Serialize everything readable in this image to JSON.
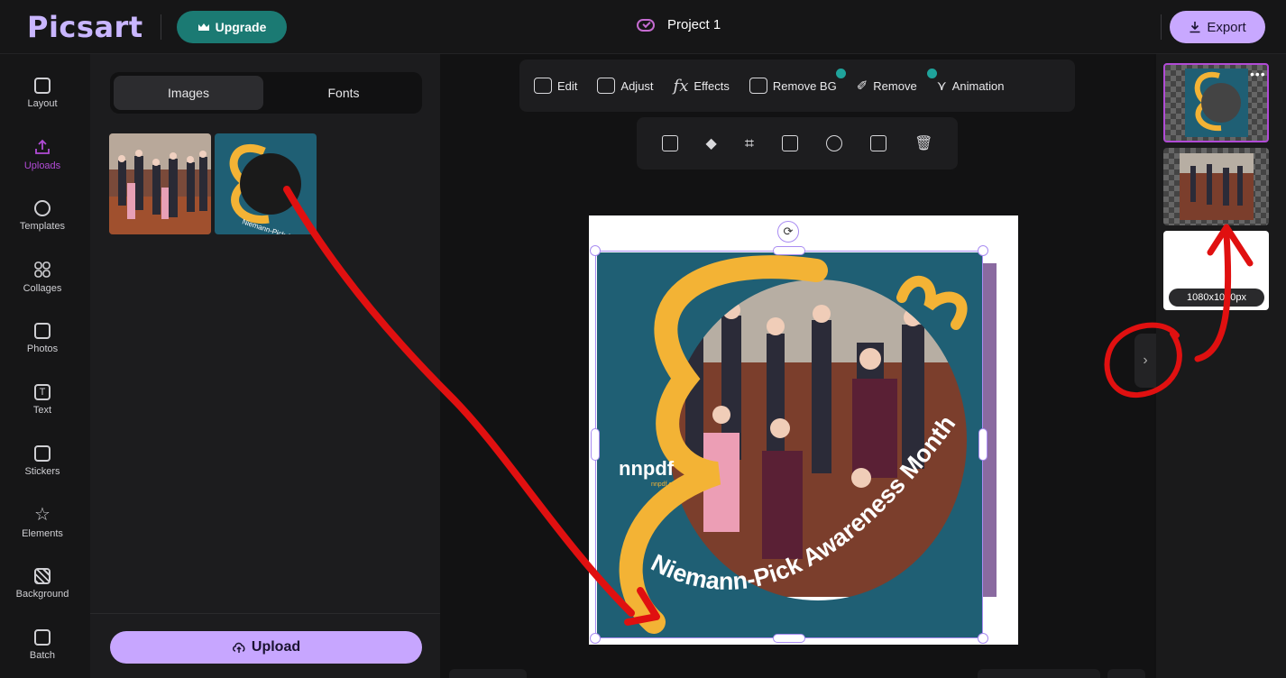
{
  "app": {
    "logo": "Picsart",
    "upgrade_label": "Upgrade",
    "project_title": "Project 1",
    "export_label": "Export"
  },
  "leftnav": {
    "items": [
      {
        "label": "Layout",
        "icon": "layout-icon"
      },
      {
        "label": "Uploads",
        "icon": "upload-icon",
        "active": true
      },
      {
        "label": "Templates",
        "icon": "templates-icon"
      },
      {
        "label": "Collages",
        "icon": "collages-icon"
      },
      {
        "label": "Photos",
        "icon": "photos-icon"
      },
      {
        "label": "Text",
        "icon": "text-icon"
      },
      {
        "label": "Stickers",
        "icon": "stickers-icon"
      },
      {
        "label": "Elements",
        "icon": "star-icon"
      },
      {
        "label": "Background",
        "icon": "background-icon"
      },
      {
        "label": "Batch",
        "icon": "batch-icon"
      }
    ]
  },
  "panel": {
    "tabs": [
      "Images",
      "Fonts"
    ],
    "upload_label": "Upload"
  },
  "toolbar": {
    "tools": [
      "Edit",
      "Adjust",
      "Effects",
      "Remove BG",
      "Remove",
      "Animation"
    ],
    "fx_glyph": "fx"
  },
  "canvas": {
    "frame_text": "Niemann-Pick Awareness Month",
    "logo_text": "nnpdf",
    "logo_sub": "nnpdf.org"
  },
  "pages": {
    "size_label": "1080x1080px"
  },
  "colors": {
    "accent": "#c7a6ff",
    "upgrade": "#1b7a73",
    "active_nav": "#b14bd6",
    "frame_teal": "#1f5f74",
    "frame_yellow": "#f3b335",
    "annotation_red": "#e01010"
  }
}
